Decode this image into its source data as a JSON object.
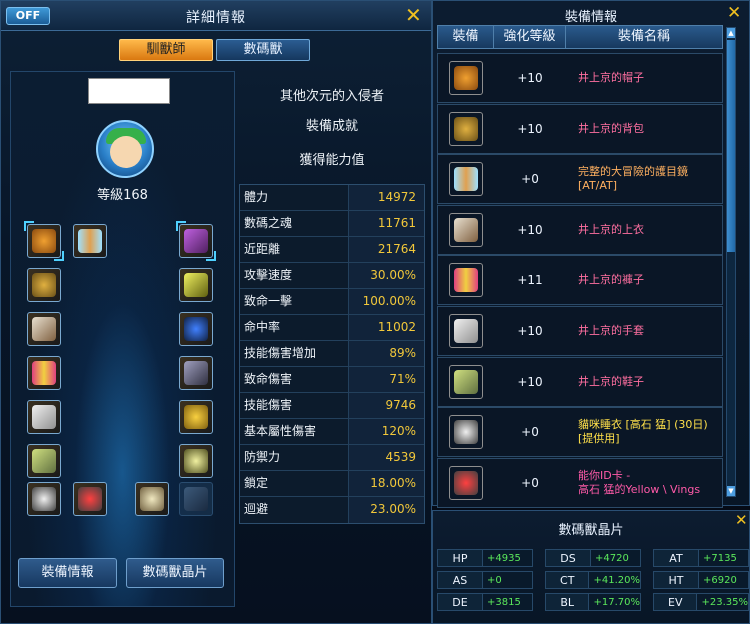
{
  "detail_window": {
    "title": "詳細情報",
    "off_label": "OFF",
    "tabs": [
      {
        "label": "馴獸師",
        "active": true
      },
      {
        "label": "數碼獸",
        "active": false
      }
    ],
    "character": {
      "level_text": "等級168"
    },
    "right_info": {
      "title_line": "其他次元的入侵者",
      "achievement": "裝備成就",
      "stats_title": "獲得能力值"
    },
    "stats": [
      {
        "label": "體力",
        "value": "14972"
      },
      {
        "label": "數碼之魂",
        "value": "11761"
      },
      {
        "label": "近距離",
        "value": "21764"
      },
      {
        "label": "攻擊速度",
        "value": "30.00%"
      },
      {
        "label": "致命一擊",
        "value": "100.00%"
      },
      {
        "label": "命中率",
        "value": "11002"
      },
      {
        "label": "技能傷害增加",
        "value": "89%"
      },
      {
        "label": "致命傷害",
        "value": "71%"
      },
      {
        "label": "技能傷害",
        "value": "9746"
      },
      {
        "label": "基本屬性傷害",
        "value": "120%"
      },
      {
        "label": "防禦力",
        "value": "4539"
      },
      {
        "label": "鎖定",
        "value": "18.00%"
      },
      {
        "label": "迴避",
        "value": "23.00%"
      }
    ],
    "buttons": {
      "equip_info": "裝備情報",
      "digimon_shard": "數碼獸晶片"
    }
  },
  "equip_window": {
    "title": "裝備情報",
    "headers": {
      "equip": "裝備",
      "level": "強化等級",
      "name": "裝備名稱"
    },
    "rows": [
      {
        "level": "+10",
        "name": "井上京的帽子",
        "color": "#ff6fa0",
        "icon": "hat-icon"
      },
      {
        "level": "+10",
        "name": "井上京的背包",
        "color": "#ff6fa0",
        "icon": "backpack-icon"
      },
      {
        "level": "+0",
        "name": "完整的大冒險的護目鏡\n[AT/AT]",
        "color": "#ffb060",
        "icon": "goggles-icon"
      },
      {
        "level": "+10",
        "name": "井上京的上衣",
        "color": "#ff6fa0",
        "icon": "shirt-icon"
      },
      {
        "level": "+11",
        "name": "井上京的褲子",
        "color": "#ff6fa0",
        "icon": "pants-icon"
      },
      {
        "level": "+10",
        "name": "井上京的手套",
        "color": "#ff6fa0",
        "icon": "gloves-icon"
      },
      {
        "level": "+10",
        "name": "井上京的鞋子",
        "color": "#ff6fa0",
        "icon": "shoes-icon"
      },
      {
        "level": "+0",
        "name": "貓咪睡衣 [高石 猛] (30日)\n[提供用]",
        "color": "#ffe04a",
        "icon": "costume-icon"
      },
      {
        "level": "+0",
        "name": "能你ID卡 -\n高石 猛的Yellow \\ Vings",
        "color": "#ff5aa8",
        "icon": "id-card-icon"
      }
    ]
  },
  "shard_window": {
    "title": "數碼獸晶片",
    "cells": [
      {
        "key": "HP",
        "value": "+4935"
      },
      {
        "key": "DS",
        "value": "+4720"
      },
      {
        "key": "AT",
        "value": "+7135"
      },
      {
        "key": "AS",
        "value": "+0"
      },
      {
        "key": "CT",
        "value": "+41.20%"
      },
      {
        "key": "HT",
        "value": "+6920"
      },
      {
        "key": "DE",
        "value": "+3815"
      },
      {
        "key": "BL",
        "value": "+17.70%"
      },
      {
        "key": "EV",
        "value": "+23.35%"
      }
    ]
  },
  "close_glyph": "✕"
}
